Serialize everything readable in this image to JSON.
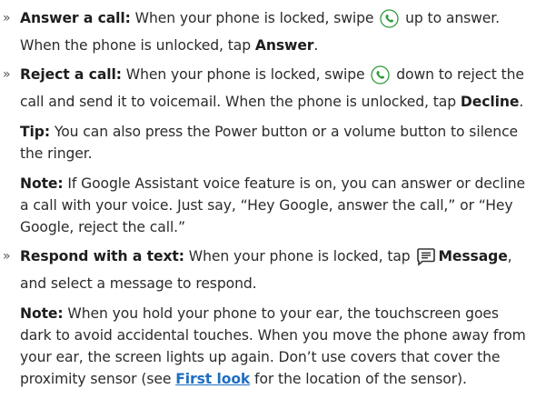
{
  "bullet_glyph": "»",
  "answer": {
    "label": "Answer a call:",
    "text1": " When your phone is locked, swipe ",
    "text2": " up to answer. When the phone is unlocked, tap ",
    "bold_end": "Answer",
    "end": "."
  },
  "reject": {
    "label": "Reject a call:",
    "text1": " When your phone is locked, swipe ",
    "text2": " down to reject the call and send it to voicemail. When the phone is unlocked, tap ",
    "bold_end": "Decline",
    "end": "."
  },
  "tip": {
    "label": "Tip:",
    "text": " You can also press the Power button or a volume button to silence the ringer."
  },
  "note1": {
    "label": "Note:",
    "text": " If Google Assistant voice feature is on, you can answer or decline a call with your voice. Just say, “Hey Google, answer the call,” or “Hey Google, reject the call.”"
  },
  "respond": {
    "label": "Respond with a text:",
    "text1": " When your phone is locked, tap ",
    "bold_msg": "Message",
    "text2": ", and select a message to respond."
  },
  "note2": {
    "label": "Note:",
    "text1": " When you hold your phone to your ear, the touchscreen goes dark to avoid accidental touches. When you move the phone away from your ear, the screen lights up again. Don’t use covers that cover the proximity sensor (see ",
    "link": "First look",
    "text2": " for the location of the sensor)."
  },
  "icons": {
    "phone": "phone-icon",
    "message": "message-icon",
    "phone_color": "#2e9b3c",
    "message_color": "#333333"
  }
}
